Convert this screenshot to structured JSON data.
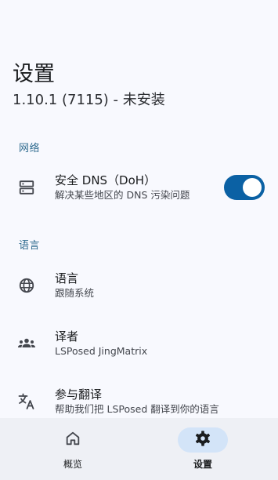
{
  "header": {
    "title": "设置",
    "subtitle": "1.10.1 (7115) - 未安装"
  },
  "sections": {
    "network": {
      "label": "网络",
      "items": [
        {
          "title": "安全 DNS（DoH）",
          "summary": "解决某些地区的 DNS 污染问题",
          "icon": "dns-icon",
          "toggle": true
        }
      ]
    },
    "language": {
      "label": "语言",
      "items": [
        {
          "title": "语言",
          "summary": "跟随系统",
          "icon": "globe-icon"
        },
        {
          "title": "译者",
          "summary": "LSPosed JingMatrix",
          "icon": "group-icon"
        },
        {
          "title": "参与翻译",
          "summary": "帮助我们把 LSPosed 翻译到你的语言",
          "icon": "translate-icon"
        }
      ]
    }
  },
  "bottom_nav": {
    "items": [
      {
        "label": "概览",
        "icon": "home-icon",
        "active": false
      },
      {
        "label": "设置",
        "icon": "gear-icon",
        "active": true
      }
    ]
  },
  "colors": {
    "accent": "#0b61a4",
    "section_label": "#2f6b8f",
    "background": "#f8f9fe",
    "nav_background": "#eef0f5",
    "nav_active_pill": "#d3e4f8"
  }
}
